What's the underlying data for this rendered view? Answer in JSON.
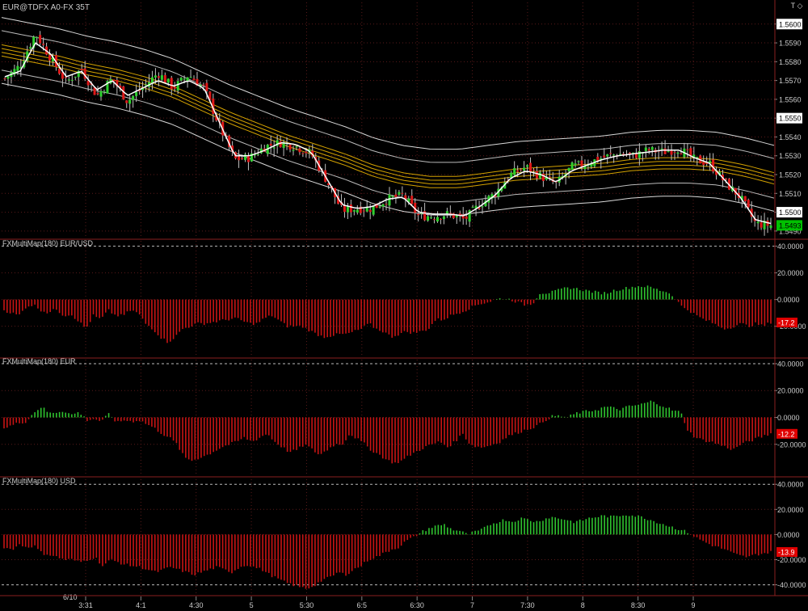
{
  "window": {
    "title": "EUR@TDFX A0-FX 35T",
    "corner_glyphs": "T ◇"
  },
  "colors": {
    "background": "#000000",
    "grid": "#5a1a1a",
    "separator": "#8a2020",
    "up_candle": "#2fd02f",
    "down_candle": "#e01818",
    "wick": "#bfbfbf",
    "ma_fast": "#ffffff",
    "band_outer": "#d9d9d9",
    "band_mid": "#bbbbbb",
    "band_inner": "#d4a200",
    "hist_pos": "#2fc42f",
    "hist_neg": "#c81414",
    "axis_text": "#cccccc",
    "price_box": "#00c000"
  },
  "x_axis": {
    "date_label": "6/10",
    "ticks": [
      "3:31",
      "4:1",
      "4:30",
      "5",
      "5:30",
      "6:5",
      "6:30",
      "7",
      "7:30",
      "8",
      "8:30",
      "9"
    ]
  },
  "chart_data": [
    {
      "type": "candlestick",
      "title": "EUR@TDFX A0-FX 35T",
      "y_ticks": [
        "1.5600",
        "1.5590",
        "1.5580",
        "1.5570",
        "1.5560",
        "1.5550",
        "1.5540",
        "1.5530",
        "1.5520",
        "1.5510",
        "1.5500",
        "1.5490"
      ],
      "y_tick_values": [
        1.56,
        1.559,
        1.558,
        1.557,
        1.556,
        1.555,
        1.554,
        1.553,
        1.552,
        1.551,
        1.55,
        1.549
      ],
      "highlighted_ticks": [
        "1.5600",
        "1.5550",
        "1.5500"
      ],
      "ylim": [
        1.54865,
        1.56115
      ],
      "last_price_label": "1.5493",
      "last_price": 1.5493,
      "close_anchors": [
        1.5571,
        1.5578,
        1.5595,
        1.5582,
        1.5569,
        1.5576,
        1.5562,
        1.5571,
        1.5559,
        1.5566,
        1.5574,
        1.5566,
        1.5573,
        1.5566,
        1.5546,
        1.5528,
        1.5529,
        1.5535,
        1.5537,
        1.5535,
        1.5531,
        1.5517,
        1.5501,
        1.5502,
        1.5502,
        1.5507,
        1.5509,
        1.5498,
        1.5498,
        1.5499,
        1.5496,
        1.5504,
        1.551,
        1.552,
        1.5524,
        1.5519,
        1.5515,
        1.5524,
        1.5526,
        1.5529,
        1.5531,
        1.553,
        1.5533,
        1.5532,
        1.5534,
        1.5528,
        1.5526,
        1.5516,
        1.5508,
        1.5494,
        1.5493
      ],
      "fast_ma_anchors": [
        1.5572,
        1.5575,
        1.559,
        1.5584,
        1.5572,
        1.5575,
        1.5565,
        1.557,
        1.5562,
        1.5566,
        1.557,
        1.5567,
        1.557,
        1.5566,
        1.5548,
        1.553,
        1.553,
        1.5533,
        1.5537,
        1.5536,
        1.5532,
        1.5518,
        1.5504,
        1.5502,
        1.5503,
        1.5507,
        1.5508,
        1.55,
        1.5499,
        1.5499,
        1.5498,
        1.5503,
        1.5509,
        1.5518,
        1.5522,
        1.552,
        1.5516,
        1.5522,
        1.5525,
        1.5528,
        1.553,
        1.5531,
        1.5532,
        1.5533,
        1.5533,
        1.5529,
        1.5526,
        1.5517,
        1.5508,
        1.5496,
        1.5494
      ],
      "band_center_anchors": [
        1.5586,
        1.5583,
        1.558,
        1.5576,
        1.5573,
        1.5569,
        1.5564,
        1.5557,
        1.555,
        1.5544,
        1.5538,
        1.5533,
        1.5528,
        1.5522,
        1.5518,
        1.5516,
        1.5516,
        1.5518,
        1.552,
        1.5521,
        1.5522,
        1.5523,
        1.5525,
        1.5526,
        1.5526,
        1.5525,
        1.5522,
        1.5518
      ],
      "band_offsets_outer": [
        0.00175,
        -0.00175
      ],
      "band_offsets_mid": [
        0.00105,
        -0.00105
      ],
      "band_offsets_inner": [
        0.0001,
        0.0003,
        -0.0001,
        -0.0003
      ]
    },
    {
      "type": "histogram",
      "title": "FXMultiMap(180) EUR/USD",
      "y_ticks": [
        "40.0000",
        "20.0000",
        "0.0000",
        "-20.0000"
      ],
      "y_tick_values": [
        40,
        20,
        0,
        -20
      ],
      "ylim": [
        -42,
        44
      ],
      "last_value_label": "-17.2",
      "last_value": -17.2,
      "anchors": [
        -8,
        -10,
        -12,
        -5,
        -4,
        -8,
        -10,
        -7,
        -12,
        -11,
        -16,
        -22,
        -12,
        -15,
        -8,
        -12,
        -12,
        -8,
        -10,
        -18,
        -22,
        -28,
        -32,
        -28,
        -22,
        -20,
        -18,
        -18,
        -17,
        -16,
        -15,
        -14,
        -16,
        -18,
        -18,
        -14,
        -12,
        -16,
        -20,
        -20,
        -20,
        -23,
        -26,
        -28,
        -27,
        -26,
        -26,
        -24,
        -22,
        -18,
        -22,
        -24,
        -28,
        -26,
        -24,
        -25,
        -24,
        -22,
        -15,
        -15,
        -12,
        -10,
        -8,
        -5,
        -3,
        -2,
        0,
        1,
        0,
        -2,
        -4,
        -3,
        5,
        5,
        6,
        8,
        9,
        8,
        7,
        6,
        5,
        5,
        7,
        8,
        9,
        10,
        10,
        9,
        7,
        6,
        2,
        -5,
        -8,
        -12,
        -15,
        -17,
        -20,
        -22,
        -20,
        -18,
        -20,
        -18,
        -20,
        -17
      ]
    },
    {
      "type": "histogram",
      "title": "FXMultiMap(180) EUR",
      "y_ticks": [
        "40.0000",
        "20.0000",
        "0.0000",
        "-20.0000"
      ],
      "y_tick_values": [
        40,
        20,
        0,
        -20
      ],
      "ylim": [
        -43,
        43
      ],
      "last_value_label": "-12.2",
      "last_value": -12.2,
      "anchors": [
        -8,
        -6,
        -4,
        -3,
        4,
        8,
        3,
        4,
        5,
        2,
        4,
        -2,
        -1,
        -3,
        3,
        -4,
        -2,
        -3,
        -2,
        -5,
        -8,
        -12,
        -15,
        -20,
        -30,
        -32,
        -30,
        -28,
        -25,
        -22,
        -20,
        -18,
        -15,
        -18,
        -15,
        -12,
        -18,
        -22,
        -26,
        -24,
        -20,
        -24,
        -28,
        -24,
        -20,
        -20,
        -12,
        -16,
        -20,
        -25,
        -28,
        -32,
        -34,
        -32,
        -28,
        -25,
        -22,
        -20,
        -18,
        -22,
        -18,
        -12,
        -20,
        -22,
        -22,
        -20,
        -18,
        -14,
        -12,
        -10,
        -8,
        -6,
        -2,
        1,
        1,
        0,
        3,
        4,
        5,
        6,
        8,
        7,
        6,
        8,
        9,
        10,
        12,
        10,
        8,
        5,
        4,
        -10,
        -15,
        -17,
        -18,
        -20,
        -22,
        -24,
        -20,
        -18,
        -16,
        -14,
        -12
      ]
    },
    {
      "type": "histogram",
      "title": "FXMultiMap(180) USD",
      "y_ticks": [
        "40.0000",
        "20.0000",
        "0.0000",
        "-20.0000",
        "-40.0000"
      ],
      "y_tick_values": [
        40,
        20,
        0,
        -20,
        -40
      ],
      "ylim": [
        -48,
        44
      ],
      "last_value_label": "-13.9",
      "last_value": -13.9,
      "anchors": [
        -10,
        -12,
        -8,
        -10,
        -9,
        -15,
        -16,
        -18,
        -20,
        -20,
        -22,
        -20,
        -18,
        -25,
        -20,
        -22,
        -24,
        -25,
        -26,
        -28,
        -30,
        -28,
        -26,
        -28,
        -30,
        -32,
        -30,
        -28,
        -26,
        -28,
        -30,
        -26,
        -24,
        -26,
        -28,
        -32,
        -35,
        -38,
        -40,
        -42,
        -43,
        -40,
        -36,
        -34,
        -30,
        -32,
        -28,
        -25,
        -20,
        -18,
        -15,
        -12,
        -10,
        -5,
        -2,
        2,
        5,
        7,
        8,
        4,
        3,
        0,
        2,
        4,
        8,
        10,
        12,
        10,
        13,
        12,
        10,
        12,
        14,
        13,
        12,
        10,
        11,
        13,
        14,
        15,
        14,
        15,
        16,
        15,
        14,
        12,
        10,
        8,
        6,
        4,
        2,
        -2,
        -5,
        -8,
        -10,
        -12,
        -15,
        -17,
        -18,
        -16,
        -15,
        -14
      ]
    }
  ]
}
